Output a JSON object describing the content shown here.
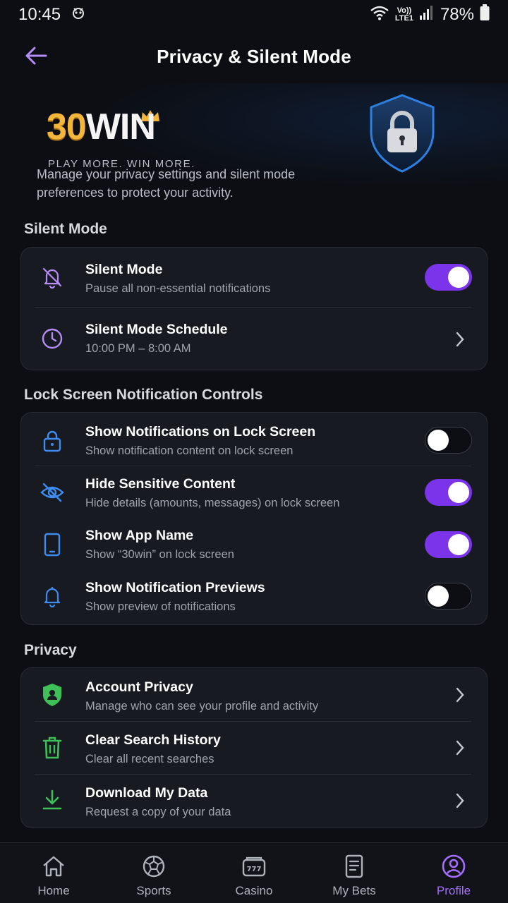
{
  "status": {
    "time": "10:45",
    "net_top": "Vo))",
    "net_bottom": "LTE1",
    "battery": "78%"
  },
  "header": {
    "title": "Privacy & Silent Mode"
  },
  "hero": {
    "logo_30": "30",
    "logo_win": "WIN",
    "tagline": "PLAY MORE. WIN MORE.",
    "description": "Manage your privacy settings and silent mode preferences to protect your activity."
  },
  "sections": {
    "silent_mode": "Silent Mode",
    "lock_screen": "Lock Screen Notification Controls",
    "privacy": "Privacy"
  },
  "silent": {
    "mode": {
      "title": "Silent Mode",
      "subtitle": "Pause all non-essential notifications",
      "enabled": true
    },
    "schedule": {
      "title": "Silent Mode Schedule",
      "subtitle": "10:00 PM – 8:00 AM"
    }
  },
  "lock": {
    "show_notifications": {
      "title": "Show Notifications on Lock Screen",
      "subtitle": "Show notification content on lock screen",
      "enabled": false
    },
    "hide_sensitive": {
      "title": "Hide Sensitive Content",
      "subtitle": "Hide details (amounts, messages) on lock screen",
      "enabled": true
    },
    "show_app_name": {
      "title": "Show App Name",
      "subtitle": "Show “30win” on lock screen",
      "enabled": true
    },
    "show_previews": {
      "title": "Show Notification Previews",
      "subtitle": "Show preview of notifications",
      "enabled": false
    }
  },
  "privacy": {
    "account": {
      "title": "Account Privacy",
      "subtitle": "Manage who can see your profile and activity"
    },
    "clear_search": {
      "title": "Clear Search History",
      "subtitle": "Clear all recent searches"
    },
    "download": {
      "title": "Download My Data",
      "subtitle": "Request a copy of your data"
    }
  },
  "nav": {
    "home": "Home",
    "sports": "Sports",
    "casino": "Casino",
    "my_bets": "My Bets",
    "profile": "Profile",
    "active": "profile"
  },
  "colors": {
    "accent": "#7b34ea",
    "accent_text": "#a56dfb",
    "icon_purple": "#b68cf7",
    "icon_blue": "#3e8cf0",
    "icon_green": "#3fbf58",
    "logo_gold": "#f4b63a"
  }
}
